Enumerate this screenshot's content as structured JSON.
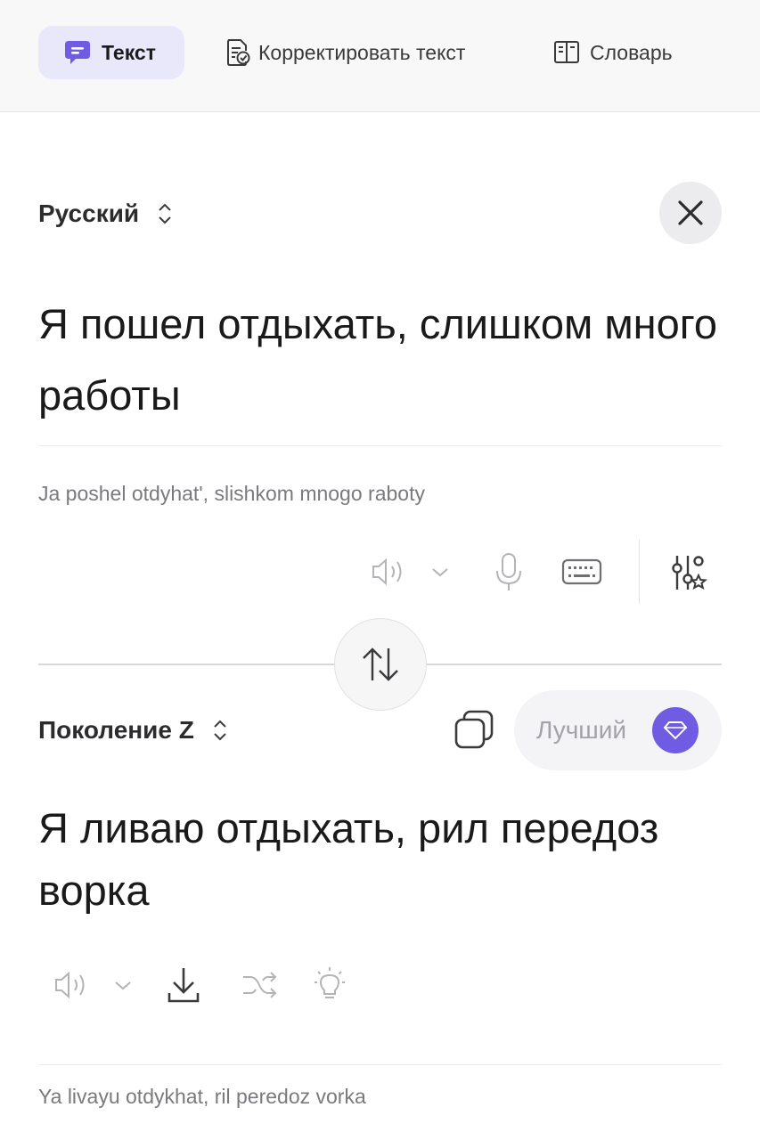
{
  "tabs": [
    {
      "label": "Текст",
      "icon": "chat-bubble-icon",
      "active": true
    },
    {
      "label": "Корректировать текст",
      "icon": "document-check-icon",
      "active": false
    },
    {
      "label": "Словарь",
      "icon": "book-icon",
      "active": false
    }
  ],
  "source": {
    "language": "Русский",
    "text": "Я пошел отдыхать, слишком много работы",
    "transliteration": "Ja poshel otdyhat', slishkom mnogo raboty"
  },
  "target": {
    "language": "Поколение Z",
    "text": "Я ливаю отдыхать, рил передоз ворка",
    "transliteration": "Ya livayu otdykhat, ril peredoz vorka",
    "quality_label": "Лучший"
  },
  "colors": {
    "accent": "#6f5ce3",
    "active_tab_bg": "#e9e8fb",
    "topbar_bg": "#f8f8f9",
    "icon_muted": "#b4b4b8"
  }
}
